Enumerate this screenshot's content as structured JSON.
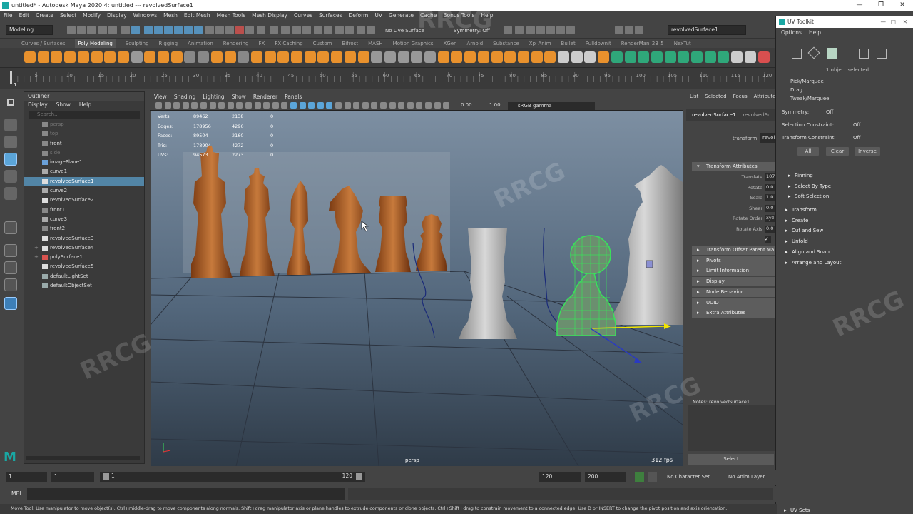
{
  "window": {
    "title": "untitled* - Autodesk Maya 2020.4: untitled  ---  revolvedSurface1",
    "controls": [
      "—",
      "❐",
      "✕"
    ]
  },
  "menu_bar": [
    "File",
    "Edit",
    "Create",
    "Select",
    "Modify",
    "Display",
    "Windows",
    "Mesh",
    "Edit Mesh",
    "Mesh Tools",
    "Mesh Display",
    "Curves",
    "Surfaces",
    "Deform",
    "UV",
    "Generate",
    "Cache",
    "Bonus Tools",
    "Help"
  ],
  "status_line": {
    "workspace": "Modeling",
    "live_surface": "No Live Surface",
    "symmetry": "Symmetry: Off",
    "object_field": "revolvedSurface1"
  },
  "shelf_tabs": [
    "Curves / Surfaces",
    "Poly Modeling",
    "Sculpting",
    "Rigging",
    "Animation",
    "Rendering",
    "FX",
    "FX Caching",
    "Custom",
    "Bifrost",
    "MASH",
    "Motion Graphics",
    "XGen",
    "Arnold",
    "Substance",
    "Xp_Anim",
    "Bullet",
    "Pulldownit",
    "RenderMan_23_5",
    "NexTut"
  ],
  "timeline": {
    "ticks": [
      "5",
      "10",
      "15",
      "20",
      "25",
      "30",
      "35",
      "40",
      "45",
      "50",
      "55",
      "60",
      "65",
      "70",
      "75",
      "80",
      "85",
      "90",
      "95",
      "100",
      "105",
      "110",
      "115",
      "120"
    ],
    "current": "1"
  },
  "outliner": {
    "title": "Outliner",
    "menu": [
      "Display",
      "Show",
      "Help"
    ],
    "search": "Search...",
    "items": [
      {
        "label": "persp",
        "dim": true,
        "kind": "cam"
      },
      {
        "label": "top",
        "dim": true,
        "kind": "cam"
      },
      {
        "label": "front",
        "dim": false,
        "kind": "cam"
      },
      {
        "label": "side",
        "dim": true,
        "kind": "cam"
      },
      {
        "label": "imagePlane1",
        "dim": false,
        "kind": "img"
      },
      {
        "label": "curve1",
        "dim": false,
        "kind": "crv"
      },
      {
        "label": "revolvedSurface1",
        "dim": false,
        "kind": "srf",
        "selected": true
      },
      {
        "label": "curve2",
        "dim": false,
        "kind": "crv"
      },
      {
        "label": "revolvedSurface2",
        "dim": false,
        "kind": "srf"
      },
      {
        "label": "front1",
        "dim": false,
        "kind": "cam"
      },
      {
        "label": "curve3",
        "dim": false,
        "kind": "crv"
      },
      {
        "label": "front2",
        "dim": false,
        "kind": "cam"
      },
      {
        "label": "revolvedSurface3",
        "dim": false,
        "kind": "srf"
      },
      {
        "label": "revolvedSurface4",
        "dim": false,
        "kind": "srf",
        "expand": true
      },
      {
        "label": "polySurface1",
        "dim": false,
        "kind": "poly",
        "expand": true
      },
      {
        "label": "revolvedSurface5",
        "dim": false,
        "kind": "srf"
      },
      {
        "label": "defaultLightSet",
        "dim": false,
        "kind": "set"
      },
      {
        "label": "defaultObjectSet",
        "dim": false,
        "kind": "set"
      }
    ]
  },
  "viewport": {
    "menu": [
      "View",
      "Shading",
      "Lighting",
      "Show",
      "Renderer",
      "Panels"
    ],
    "exposure": "0.00",
    "gamma": "1.00",
    "color_space": "sRGB gamma",
    "hud": [
      {
        "k": "Verts:",
        "a": "89462",
        "b": "2138",
        "c": "0"
      },
      {
        "k": "Edges:",
        "a": "178956",
        "b": "4296",
        "c": "0"
      },
      {
        "k": "Faces:",
        "a": "89504",
        "b": "2160",
        "c": "0"
      },
      {
        "k": "Tris:",
        "a": "178904",
        "b": "4272",
        "c": "0"
      },
      {
        "k": "UVs:",
        "a": "94573",
        "b": "2273",
        "c": "0"
      }
    ],
    "camera": "persp",
    "fps": "312 fps"
  },
  "attribute_editor": {
    "tabs": [
      "List",
      "Selected",
      "Focus",
      "Attributes"
    ],
    "node_tabs": [
      "revolvedSurface1",
      "revolvedSu"
    ],
    "transform_label": "transform:",
    "transform_value": "revol",
    "open_section": "Transform Attributes",
    "rows": [
      {
        "label": "Translate",
        "val": "107"
      },
      {
        "label": "Rotate",
        "val": "0.0"
      },
      {
        "label": "Scale",
        "val": "1.0"
      },
      {
        "label": "Shear",
        "val": "0.0"
      },
      {
        "label": "Rotate Order",
        "val": "xyz"
      },
      {
        "label": "Rotate Axis",
        "val": "0.0"
      }
    ],
    "sections": [
      "Transform Offset Parent Ma",
      "Pivots",
      "Limit Information",
      "Display",
      "Node Behavior",
      "UUID",
      "Extra Attributes"
    ],
    "notes": "Notes:  revolvedSurface1",
    "select_button": "Select"
  },
  "uv_toolkit": {
    "title": "UV Toolkit",
    "menu": [
      "Options",
      "Help"
    ],
    "selected_count": "1 object selected",
    "modes": [
      "Pick/Marquee",
      "Drag",
      "Tweak/Marquee"
    ],
    "symmetry_label": "Symmetry:",
    "symmetry_value": "Off",
    "sel_constraint_label": "Selection Constraint:",
    "sel_constraint_value": "Off",
    "xf_constraint_label": "Transform Constraint:",
    "xf_constraint_value": "Off",
    "buttons": [
      "All",
      "Clear",
      "Inverse"
    ],
    "sub_sections": [
      "Pinning",
      "Select By Type",
      "Soft Selection"
    ],
    "sections": [
      "Transform",
      "Create",
      "Cut and Sew",
      "Unfold",
      "Align and Snap",
      "Arrange and Layout"
    ],
    "footer": "UV Sets"
  },
  "range_slider": {
    "start": "1",
    "inner_start": "1",
    "range_start": "1",
    "range_end": "120",
    "end": "120",
    "anim_end": "200",
    "character_set": "No Character Set",
    "anim_layer": "No Anim Layer"
  },
  "command_line": {
    "label": "MEL"
  },
  "help_line": "Move Tool: Use manipulator to move object(s). Ctrl+middle-drag to move components along normals. Shift+drag manipulator axis or plane handles to extrude components or clone objects. Ctrl+Shift+drag to constrain movement to a connected edge. Use D or INSERT to change the pivot position and axis orientation.",
  "colors": {
    "accent_selected": "#5285a6",
    "wireframe_green": "#39e35a",
    "maya_teal": "#1aa7a3"
  }
}
